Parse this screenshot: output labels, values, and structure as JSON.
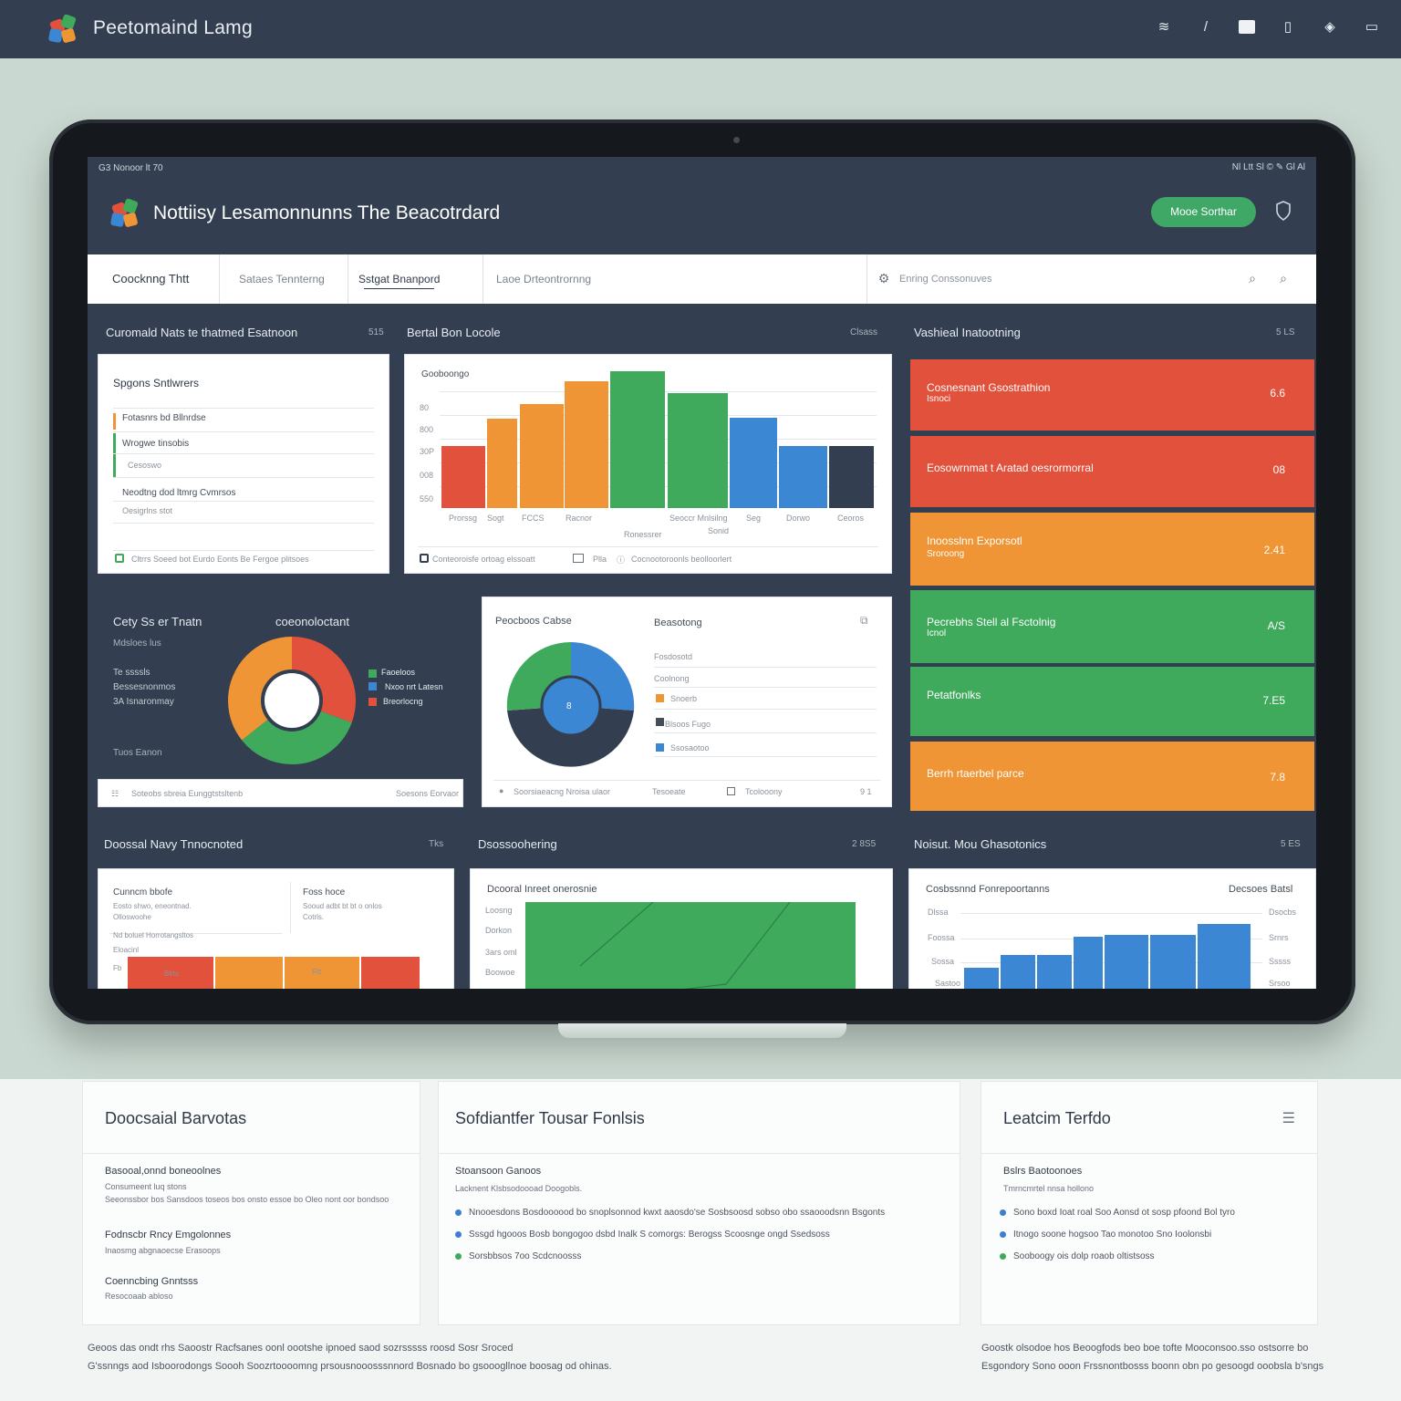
{
  "app": {
    "brand": "Peetomaind Lamg"
  },
  "device": {
    "status_left": "G3 Nonoor lt 70",
    "status_right": "Nl Ltt Sl ©  ✎ Gl Al",
    "title": "Nottiisy Lesamonnunns The Beacotrdard",
    "primary_button": "Mooe Sorthar"
  },
  "tabs": [
    {
      "label": "Coocknng Thtt"
    },
    {
      "label": "Sataes Tennterng"
    },
    {
      "label": "Sstgat Bnanpord"
    },
    {
      "label": "Laoe Drteontrornng"
    }
  ],
  "search_placeholder": "Enring Conssonuves",
  "section1": {
    "left_title": "Curomald Nats te thatmed Esatnoon",
    "left_num": "515",
    "mid_title": "Bertal Bon Locole",
    "mid_num": "Clsass",
    "right_title": "Vashieal Inatootning",
    "right_num": "5 LS"
  },
  "card_a": {
    "title": "Spgons Sntlwrers",
    "row1": "Fotasnrs bd Bllnrdse",
    "row2": "Wrogwe tinsobis",
    "row3": "Cesoswo",
    "row4": "Neodtng dod ltmrg Cvmrsos",
    "row5": "Oesigrlns stot",
    "footer": "Cltrrs Soeed bot Eurdo Eonts Be Fergoe plitsoes"
  },
  "card_b": {
    "title": "Gooboongo",
    "y_ticks": [
      "80",
      "800",
      "30P",
      "008",
      "550"
    ],
    "x_ticks": [
      "Prorssg",
      "Sogt",
      "FCCS",
      "Racnor",
      "Seoccr Mnlsilng",
      "Seg",
      "Dorwo",
      "Ceoros"
    ],
    "x_label": "Ronessrer",
    "x_label2": "Sonid",
    "footer_left": "Conteoroisfe ortoag elssoatt",
    "footer_mid": "Plla",
    "footer_right": "Cocnootoroonls beolloorlert"
  },
  "side_metrics": [
    {
      "label": "Cosnesnant Gsostrathion",
      "sub": "Isnoci",
      "value": "6.6",
      "color": "#e2513b"
    },
    {
      "label": "Eosowrnmat t Aratad oesrormorral",
      "sub": "",
      "value": "08",
      "color": "#e2513b"
    },
    {
      "label": "Inoosslnn Exporsotl",
      "sub": "Sroroong",
      "value": "2.41",
      "color": "#f09535"
    },
    {
      "label": "Pecrebhs Stell al Fsctolnig",
      "sub": "Icnol",
      "value": "A/S",
      "color": "#3faa5b"
    },
    {
      "label": "Petatfonlks",
      "sub": "",
      "value": "7.E5",
      "color": "#3faa5b"
    },
    {
      "label": "Berrh rtaerbel parce",
      "sub": "",
      "value": "7.8",
      "color": "#f09535"
    }
  ],
  "donut_panel": {
    "title": "Cety Ss er Tnatn",
    "subtitle": "coeonoloctant",
    "sub2": "Mdsloes lus",
    "l1": "Te ssssls",
    "l2": "Bessesnonmos",
    "l3": "3A Isnaronmay",
    "l4": "Tuos Eanon",
    "legend": [
      "Faoeloos",
      "Nxoo nrt Latesn",
      "Breorlocng"
    ],
    "footer_left": "Soteobs sbreia Eunggtstsltenb",
    "footer_right": "Soesons Eorvaor"
  },
  "card_c": {
    "title": "Peocboos Cabse",
    "title2": "Beasotong",
    "r1": "Fosdosotd",
    "r2": "Coolnong",
    "r3": "Snoerb",
    "r4": "Blsoos Fugo",
    "r5": "Ssosaotoo",
    "center": "8",
    "footer_left": "Soorsiaeacng Nroisa ulaor",
    "footer_mid": "Tesoeate",
    "footer_mid2": "Tcolooony",
    "footer_right": "9 1"
  },
  "section3": {
    "a_title": "Doossal Navy Tnnocnoted",
    "a_num": "Tks",
    "b_title": "Dsossoohering",
    "b_num": "2 8S5",
    "c_title": "Noisut. Mou Ghasotonics",
    "c_num": "5 ES"
  },
  "card_d": {
    "t1": "Cunncm bbofe",
    "t2": "Foss hoce",
    "s1": "Eosto shwo, eneontnad.",
    "s2": "Sooud adbt bt bt o onlos",
    "s3": "Olloswoohe",
    "s4": "Cotrls.",
    "s5": "Nd boluel Horrotangsltos",
    "s6": "Eloacinl",
    "bar_labels": [
      "Fb",
      "Blrts",
      "Rtt"
    ]
  },
  "card_e": {
    "title": "Dcooral Inreet onerosnie",
    "y": [
      "Loosng",
      "Dorkon",
      "3ars oml",
      "Boowoe"
    ]
  },
  "card_f": {
    "title": "Cosbssnnd Fonrepoortanns",
    "title2": "Decsoes Batsl",
    "y_left": [
      "Dlssa",
      "Foossa",
      "Sossa",
      "Sastoo"
    ],
    "y_right": [
      "Dsocbs",
      "Srnrs",
      "Sssss",
      "Srsoo"
    ]
  },
  "page_cards": [
    {
      "title": "Doocsaial Barvotas",
      "items": [
        {
          "t": "Basooal,onnd boneoolnes",
          "s": "Consumeent luq stons",
          "s2": "Seeonssbor bos Sansdoos toseos bos onsto essoe bo Oleo nont oor bondsoo"
        },
        {
          "t": "Fodnscbr Rncy Emgolonnes",
          "s": "Inaosmg abgnaoecse Erasoops"
        },
        {
          "t": "Coenncbing Gnntsss",
          "s": "Resocoaab abloso"
        }
      ]
    },
    {
      "title": "Sofdiantfer Tousar Fonlsis",
      "items": [
        {
          "t": "Stoansoon Ganoos",
          "s": "Lacknent Klsbsodoooad Doogobls."
        },
        {
          "b": "Nnooesdons Bosdoooood bo snoplsonnod kwxt aaosdo'se Sosbsoosd sobso obo ssaooodsnn Bsgonts",
          "c": "#3c7fd0"
        },
        {
          "b": "Sssgd hgooos Bosb bongogoo dsbd Inalk S comorgs: Berogss Scoosnge ongd Ssedsoss",
          "c": "#3c7fd0"
        },
        {
          "b": "Sorsbbsos 7oo Scdcnoosss",
          "c": "#3faa5b"
        }
      ]
    },
    {
      "title": "Leatcim Terfdo",
      "items": [
        {
          "t": "Bslrs Baotoonoes",
          "s": "Tmrncmrtel nnsa hollono"
        },
        {
          "b": "Sono boxd Ioat roal Soo Aonsd ot sosp pfoond Bol tyro",
          "c": "#3c7fd0"
        },
        {
          "b": "Itnogo soone hogsoo Tao monotoo Sno Ioolonsbi",
          "c": "#3c7fd0"
        },
        {
          "b": "Sooboogy ois dolp roaob oltistsoss",
          "c": "#3faa5b"
        }
      ]
    }
  ],
  "footer": {
    "left1": "Geoos das ondt rhs Saoostr Racfsanes oonl oootshe ipnoed saod sozrsssss roosd Sosr Sroced",
    "left2": "G'ssnngs aod Isboorodongs Soooh Soozrtoooomng prsousnooosssnnord Bosnado bo gsooogllnoe boosag od ohinas.",
    "right1": "Goostk olsodoe hos Beoogfods beo boe tofte Mooconsoo.sso ostsorre bo",
    "right2": "Esgondory Sono ooon Frssnontbosss boonn obn po gesoogd ooobsla b'sngs"
  },
  "colors": {
    "red": "#e2513b",
    "orange": "#f09535",
    "green": "#3faa5b",
    "blue": "#3c87d4",
    "navy": "#333f50"
  }
}
